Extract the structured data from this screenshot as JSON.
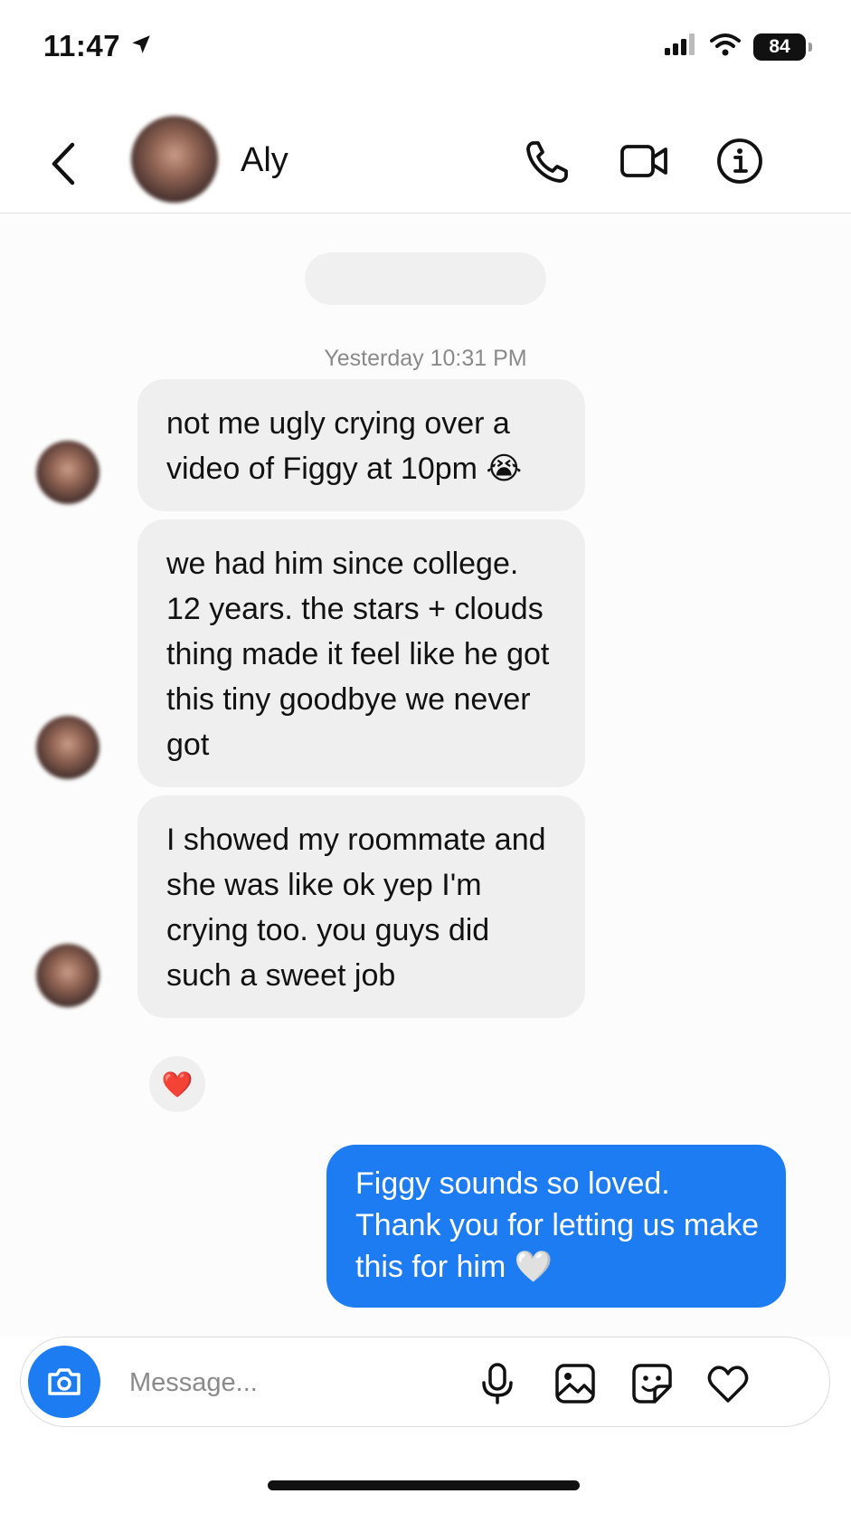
{
  "status_bar": {
    "time": "11:47",
    "battery": "84",
    "icons": [
      "location-arrow-icon",
      "signal-icon",
      "wifi-icon",
      "battery-icon"
    ]
  },
  "header": {
    "contact_name": "Aly",
    "icons": [
      "back-chevron-icon",
      "phone-icon",
      "video-camera-icon",
      "info-icon"
    ]
  },
  "chat": {
    "timestamp": "Yesterday 10:31 PM",
    "incoming": [
      {
        "text": "not me ugly crying over a video of Figgy at 10pm 😭"
      },
      {
        "text": "we had him since college. 12 years. the stars + clouds thing made it feel like he got this tiny goodbye we never got"
      },
      {
        "text": "I showed my roommate and she was like ok yep I'm crying too. you guys did such a sweet job"
      }
    ],
    "reaction": "❤️",
    "outgoing": [
      {
        "text": "Figgy sounds so loved. Thank you for letting us make this for him 🤍"
      }
    ]
  },
  "composer": {
    "placeholder": "Message...",
    "icons": [
      "camera-icon",
      "microphone-icon",
      "gallery-icon",
      "sticker-icon",
      "heart-icon"
    ]
  },
  "colors": {
    "accent": "#1e7cf2",
    "incoming_bubble": "#efefef",
    "timestamp_text": "#8a8a8a"
  }
}
